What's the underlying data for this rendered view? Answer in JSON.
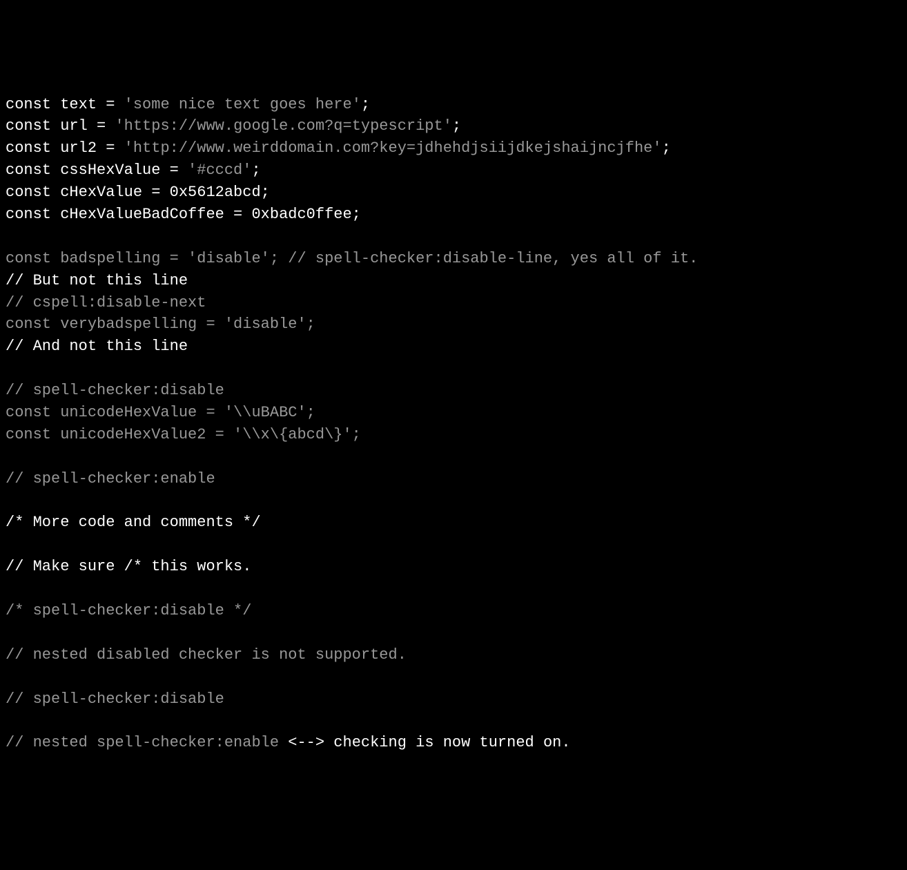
{
  "lines": [
    {
      "segments": [
        {
          "cls": "white",
          "text": "const text = "
        },
        {
          "cls": "gray",
          "text": "'some nice text goes here'"
        },
        {
          "cls": "white",
          "text": ";"
        }
      ]
    },
    {
      "segments": [
        {
          "cls": "white",
          "text": "const url = "
        },
        {
          "cls": "gray",
          "text": "'https://www.google.com?q=typescript'"
        },
        {
          "cls": "white",
          "text": ";"
        }
      ]
    },
    {
      "segments": [
        {
          "cls": "white",
          "text": "const url2 = "
        },
        {
          "cls": "gray",
          "text": "'http://www.weirddomain.com?key=jdhehdjsiijdkejshaijncjfhe'"
        },
        {
          "cls": "white",
          "text": ";"
        }
      ]
    },
    {
      "segments": [
        {
          "cls": "white",
          "text": "const cssHexValue = "
        },
        {
          "cls": "gray",
          "text": "'#cccd'"
        },
        {
          "cls": "white",
          "text": ";"
        }
      ]
    },
    {
      "segments": [
        {
          "cls": "white",
          "text": "const cHexValue = 0x5612abcd;"
        }
      ]
    },
    {
      "segments": [
        {
          "cls": "white",
          "text": "const cHexValueBadCoffee = 0xbadc0ffee;"
        }
      ]
    },
    {
      "segments": []
    },
    {
      "segments": [
        {
          "cls": "gray",
          "text": "const badspelling = 'disable'; // spell-checker:disable-line, yes all of it."
        }
      ]
    },
    {
      "segments": [
        {
          "cls": "white",
          "text": "// But not this line"
        }
      ]
    },
    {
      "segments": [
        {
          "cls": "gray",
          "text": "// cspell:disable-next"
        }
      ]
    },
    {
      "segments": [
        {
          "cls": "gray",
          "text": "const verybadspelling = 'disable';"
        }
      ]
    },
    {
      "segments": [
        {
          "cls": "white",
          "text": "// And not this line"
        }
      ]
    },
    {
      "segments": []
    },
    {
      "segments": [
        {
          "cls": "gray",
          "text": "// spell-checker:disable"
        }
      ]
    },
    {
      "segments": [
        {
          "cls": "gray",
          "text": "const unicodeHexValue = '\\\\uBABC';"
        }
      ]
    },
    {
      "segments": [
        {
          "cls": "gray",
          "text": "const unicodeHexValue2 = '\\\\x\\{abcd\\}';"
        }
      ]
    },
    {
      "segments": []
    },
    {
      "segments": [
        {
          "cls": "gray",
          "text": "// spell-checker:enable"
        }
      ]
    },
    {
      "segments": []
    },
    {
      "segments": [
        {
          "cls": "white",
          "text": "/* More code and comments */"
        }
      ]
    },
    {
      "segments": []
    },
    {
      "segments": [
        {
          "cls": "white",
          "text": "// Make sure /* this works."
        }
      ]
    },
    {
      "segments": []
    },
    {
      "segments": [
        {
          "cls": "gray",
          "text": "/* spell-checker:disable */"
        }
      ]
    },
    {
      "segments": []
    },
    {
      "segments": [
        {
          "cls": "gray",
          "text": "// nested disabled checker is not supported."
        }
      ]
    },
    {
      "segments": []
    },
    {
      "segments": [
        {
          "cls": "gray",
          "text": "// spell-checker:disable"
        }
      ]
    },
    {
      "segments": []
    },
    {
      "segments": [
        {
          "cls": "gray",
          "text": "// nested spell-checker:enable"
        },
        {
          "cls": "white",
          "text": " <--> checking is now turned on."
        }
      ]
    }
  ]
}
